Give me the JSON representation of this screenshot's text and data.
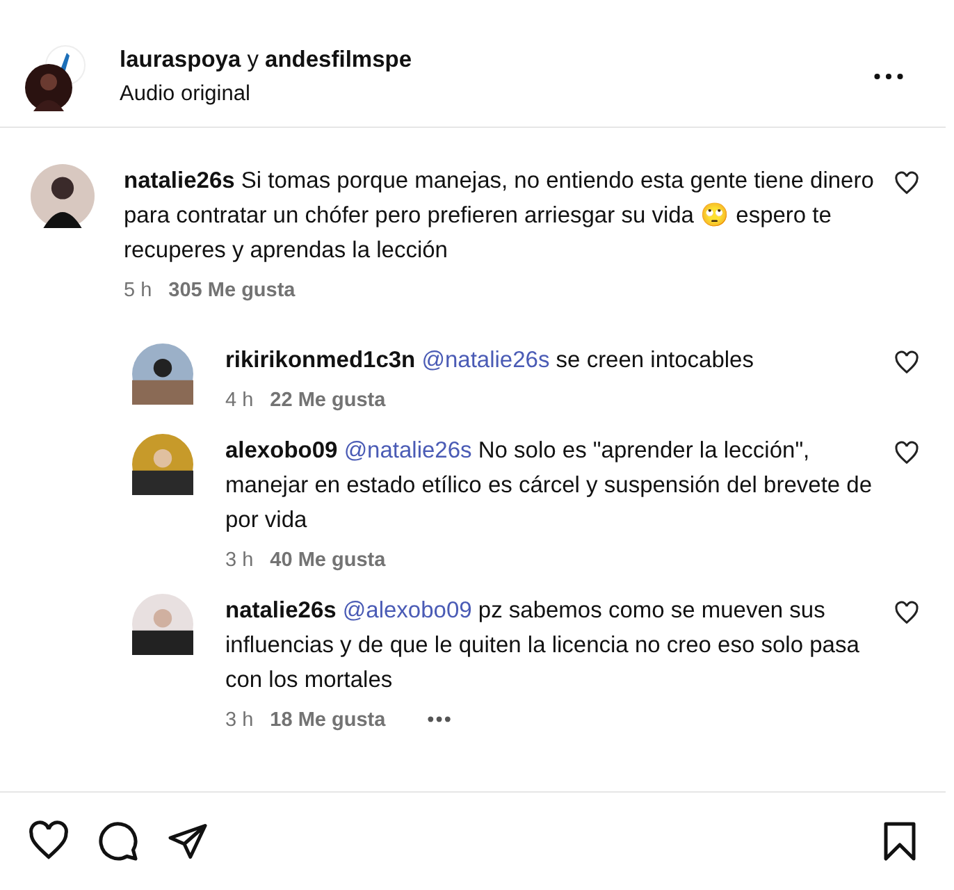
{
  "header": {
    "title": "**lauraspoya** y **andesfilmspe**",
    "subtitle": "Audio original"
  },
  "comments": [
    {
      "user": "natalie26s",
      "text": "Si tomas porque manejas, no entiendo esta gente tiene dinero para contratar un chófer pero prefieren arriesgar su vida 🙄 espero te recuperes y aprendas la lección",
      "time": "5 h",
      "likes": "305 Me gusta",
      "replies": [
        {
          "user": "rikirikonmed1c3n",
          "mention": "@natalie26s",
          "text": "se creen intocables",
          "time": "4 h",
          "likes": "22 Me gusta"
        },
        {
          "user": "alexobo09",
          "mention": "@natalie26s",
          "text": "No solo es \"aprender la lección\", manejar en estado etílico es cárcel y suspensión del brevete de por vida",
          "time": "3 h",
          "likes": "40 Me gusta"
        },
        {
          "user": "natalie26s",
          "mention": "@alexobo09",
          "text": "pz sabemos como se mueven sus influencias y de que le quiten la licencia no creo eso solo pasa con los mortales",
          "time": "3 h",
          "likes": "18 Me gusta",
          "more": "•••"
        }
      ]
    }
  ]
}
